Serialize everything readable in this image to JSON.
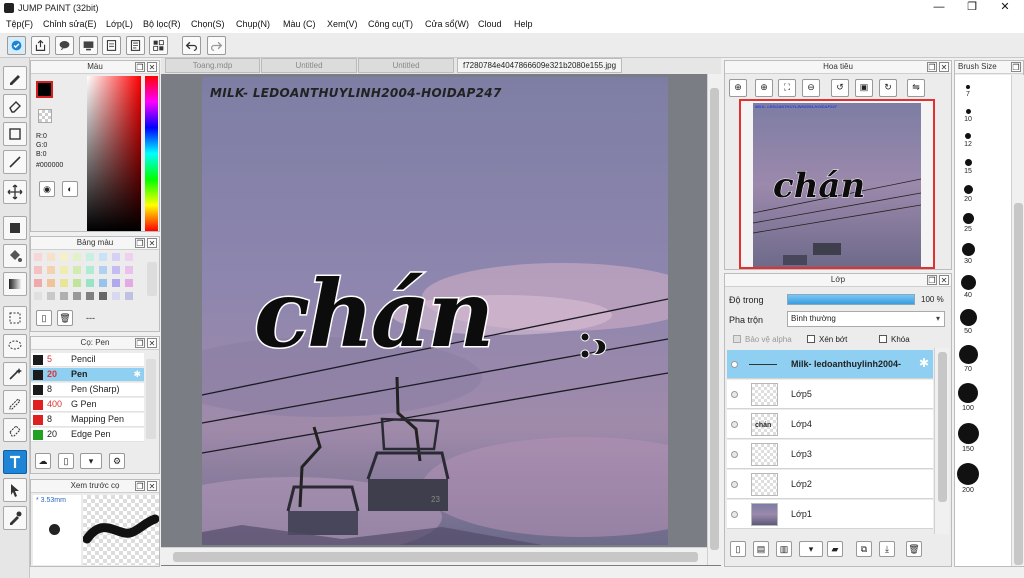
{
  "window": {
    "title": "JUMP PAINT (32bit)",
    "min": "—",
    "max": "❐",
    "close": "✕"
  },
  "menu": [
    "Tệp(F)",
    "Chỉnh sửa(E)",
    "Lớp(L)",
    "Bộ lọc(R)",
    "Chọn(S)",
    "Chụp(N)",
    "Màu (C)",
    "Xem(V)",
    "Công cụ(T)",
    "Cửa sổ(W)",
    "Cloud",
    "Help"
  ],
  "color_panel": {
    "title": "Màu",
    "r": "R:0",
    "g": "G:0",
    "b": "B:0",
    "hex": "#000000"
  },
  "palette_panel": {
    "title": "Bảng màu",
    "name": "---"
  },
  "brush_panel": {
    "title": "Cọ: Pen",
    "items": [
      {
        "size": "5",
        "name": "Pencil",
        "color": "#1a1a1a",
        "size_color": "#d33"
      },
      {
        "size": "20",
        "name": "Pen",
        "color": "#1a1a1a",
        "size_color": "#d33"
      },
      {
        "size": "8",
        "name": "Pen (Sharp)",
        "color": "#1a1a1a",
        "size_color": "#222"
      },
      {
        "size": "400",
        "name": "G Pen",
        "color": "#e02020",
        "size_color": "#d33"
      },
      {
        "size": "8",
        "name": "Mapping Pen",
        "color": "#e02020",
        "size_color": "#222"
      },
      {
        "size": "20",
        "name": "Edge Pen",
        "color": "#22a022",
        "size_color": "#222"
      }
    ]
  },
  "preview_panel": {
    "title": "Xem trước cọ",
    "size": "3.53mm"
  },
  "tabs": [
    {
      "label": "Toang.mdp",
      "active": false
    },
    {
      "label": "Untitled",
      "active": false
    },
    {
      "label": "Untitled",
      "active": false
    },
    {
      "label": "f7280784e4047866609e321b2080e155.jpg",
      "active": true
    }
  ],
  "artwork": {
    "watermark": "MILK- LEDOANTHUYLINH2004-HOIDAP247",
    "big_text": "chán",
    "watermark_color": "#2244dd"
  },
  "navigator": {
    "title": "Hoa tiêu",
    "watermark": "MILK- LEDOANTHUYLINH2004-HOIDAP247",
    "big_text": "chán"
  },
  "layer_panel": {
    "title": "Lớp",
    "opacity_label": "Độ trong",
    "opacity_value": "100 %",
    "opacity": 1.0,
    "blend_label": "Pha trộn",
    "blend_value": "Bình thường",
    "protect_alpha": "Bảo vệ alpha",
    "clipping": "Xén bớt",
    "lock": "Khóa",
    "layers": [
      {
        "name": "Milk- ledoanthuylinh2004-",
        "selected": true
      },
      {
        "name": "Lớp5",
        "selected": false
      },
      {
        "name": "Lớp4",
        "selected": false
      },
      {
        "name": "Lớp3",
        "selected": false
      },
      {
        "name": "Lớp2",
        "selected": false
      },
      {
        "name": "Lớp1",
        "selected": false
      }
    ]
  },
  "brush_size_panel": {
    "title": "Brush Size",
    "sizes": [
      "7",
      "10",
      "12",
      "15",
      "20",
      "25",
      "30",
      "40",
      "50",
      "70",
      "100",
      "150",
      "200"
    ]
  },
  "colors": {
    "accent": "#1e84d6",
    "selection": "#8fd0f2",
    "canvas_bg": "#7a7d84"
  }
}
